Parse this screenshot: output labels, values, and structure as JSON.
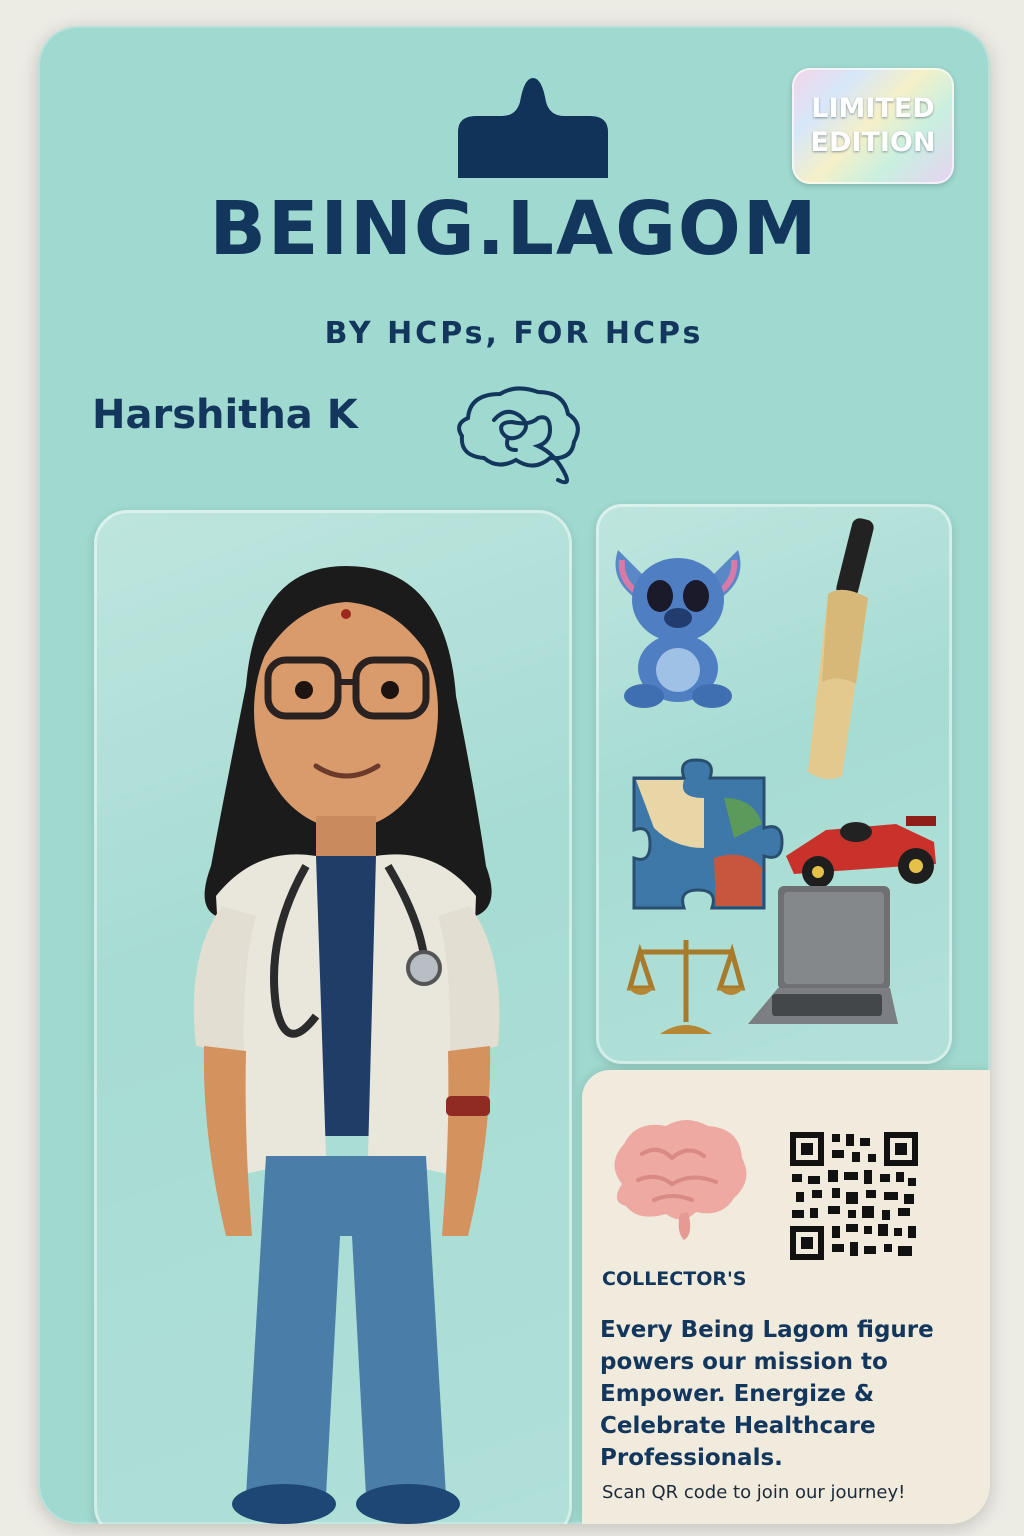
{
  "badge": {
    "line1": "LIMITED",
    "line2": "EDITION"
  },
  "brand": {
    "title": "BEING.LAGOM",
    "tagline": "BY HCPs, FOR HCPs"
  },
  "figure": {
    "name": "Harshitha K"
  },
  "accessories": [
    "stitch-plush-icon",
    "cricket-bat-icon",
    "puzzle-piece-icon",
    "race-car-icon",
    "scales-of-justice-icon",
    "laptop-icon"
  ],
  "panel": {
    "collector_label": "COLLECTOR'S",
    "mission_line1": "Every Being Lagom figure",
    "mission_line2": "powers our mission to",
    "mission_line3": "Empower. Energize &",
    "mission_line4": "Celebrate Healthcare",
    "mission_line5": "Professionals.",
    "scan_text": "Scan QR code to join our journey!"
  },
  "colors": {
    "card": "#9fd9cf",
    "navy": "#13365c",
    "panel": "#f1ebdd"
  }
}
